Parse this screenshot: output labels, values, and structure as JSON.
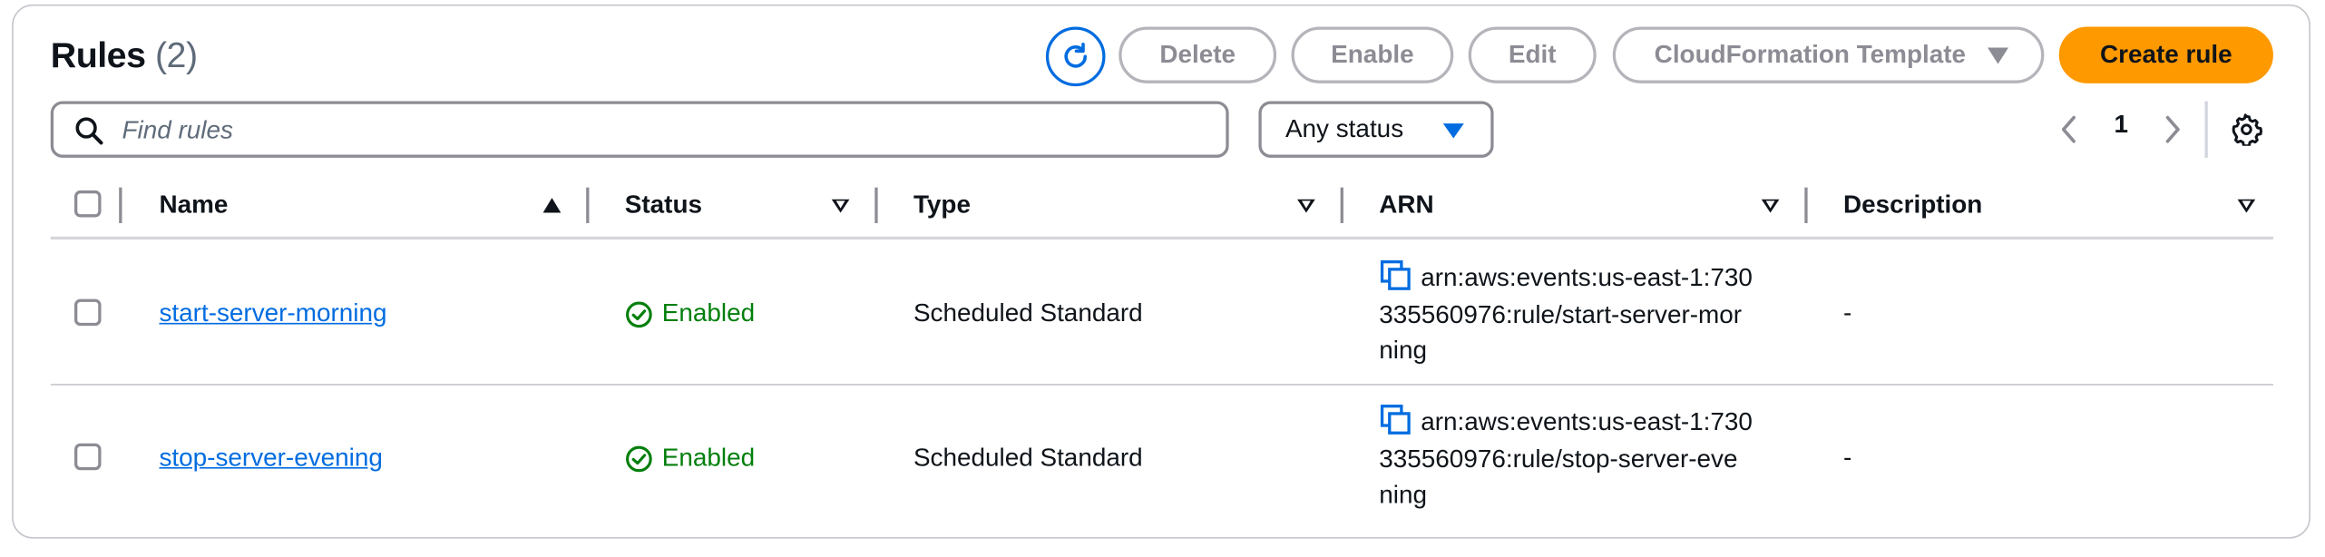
{
  "header": {
    "title": "Rules",
    "count": "(2)"
  },
  "toolbar": {
    "refresh_icon": "refresh-icon",
    "delete_label": "Delete",
    "enable_label": "Enable",
    "edit_label": "Edit",
    "cfn_label": "CloudFormation Template",
    "create_label": "Create rule"
  },
  "search": {
    "placeholder": "Find rules",
    "value": ""
  },
  "status_filter": {
    "selected": "Any status"
  },
  "pagination": {
    "current_page": "1"
  },
  "table": {
    "columns": [
      "Name",
      "Status",
      "Type",
      "ARN",
      "Description"
    ],
    "rows": [
      {
        "name": "start-server-morning",
        "status": "Enabled",
        "type": "Scheduled Standard",
        "arn_lines": [
          "arn:aws:events:us-east-1:730",
          "335560976:rule/start-server-mor",
          "ning"
        ],
        "description": "-"
      },
      {
        "name": "stop-server-evening",
        "status": "Enabled",
        "type": "Scheduled Standard",
        "arn_lines": [
          "arn:aws:events:us-east-1:730",
          "335560976:rule/stop-server-eve",
          "ning"
        ],
        "description": "-"
      }
    ]
  },
  "colors": {
    "accent": "#006ce0",
    "primary": "#ff9900",
    "success": "#037f0c"
  }
}
